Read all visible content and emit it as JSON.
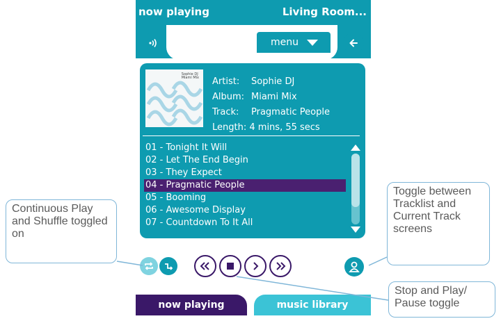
{
  "header": {
    "title": "now playing",
    "room": "Living Room..."
  },
  "toolbar": {
    "menu_label": "menu"
  },
  "track_info": {
    "artist_label": "Artist:",
    "artist": "Sophie DJ",
    "album_label": "Album:",
    "album": "Miami Mix",
    "track_label": "Track:",
    "track": "Pragmatic People",
    "length_label": "Length:",
    "length": "4 mins, 55 secs",
    "art_text_line1": "Sophie DJ",
    "art_text_line2": "Miami Mix"
  },
  "tracklist": [
    "01 - Tonight It Will",
    "02 - Let The End Begin",
    "03 - They Expect",
    "04 - Pragmatic People",
    "05 - Booming",
    "06 - Awesome Display",
    "07 - Countdown To It All"
  ],
  "selected_index": 3,
  "scroll_fraction_visible": 0.75,
  "tabs": {
    "now_playing": "now playing",
    "music_library": "music library"
  },
  "callouts": {
    "left": "Continuous Play and Shuffle toggled on",
    "right": "Toggle between Tracklist and Current Track screens",
    "stop": "Stop and Play/ Pause toggle"
  },
  "colors": {
    "teal": "#0e9bb0",
    "purple": "#3a1868",
    "light_teal": "#3bc3d6",
    "callout_border": "#7fb6d8"
  },
  "icons": [
    "speaker-icon",
    "back-arrow-icon",
    "repeat-icon",
    "shuffle-icon",
    "rewind-icon",
    "stop-icon",
    "next-icon",
    "fast-forward-icon",
    "user-icon"
  ]
}
